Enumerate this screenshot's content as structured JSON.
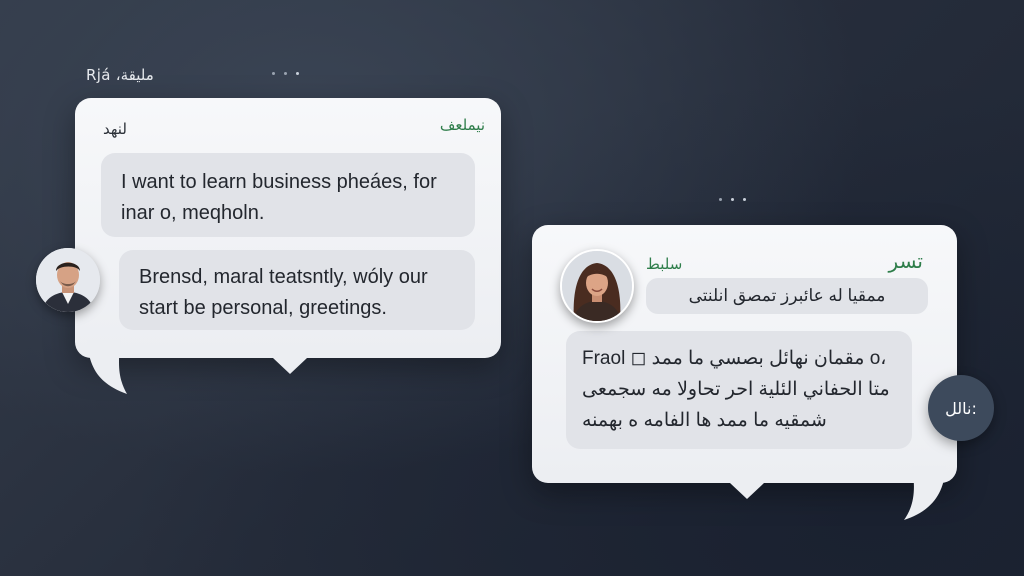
{
  "header": {
    "label": "Rjá ،مليقة"
  },
  "left_card": {
    "header_left": "لنهد",
    "header_right": "نيملعف",
    "messages": [
      {
        "text": "I want to learn business pheáes, for inar o, meqholn."
      },
      {
        "text": "Brensd, maral teatsntly, wóly our start be personal, greetings."
      }
    ]
  },
  "right_card": {
    "header_left": "سلبط",
    "header_right": "تسر",
    "chip_text": "ممقيا له عائبرز تمصق انلنتى",
    "message_text": "Fraol ◻ مقمان نهائل بصسي ما ممد o، متا الحفاني الئلية احر تحاولا مه سجمعى شمقيه ما ممد ها الفامه ه بهمنه"
  },
  "badge": {
    "text": "نالل:"
  },
  "colors": {
    "background": "#2a3240",
    "card": "#f2f4f7",
    "bubble": "#e1e3e8",
    "accent_green": "#2e7d4a",
    "badge": "#3d4a5c"
  },
  "icons": {
    "left_avatar": "man-portrait-avatar",
    "right_avatar": "woman-portrait-avatar"
  }
}
